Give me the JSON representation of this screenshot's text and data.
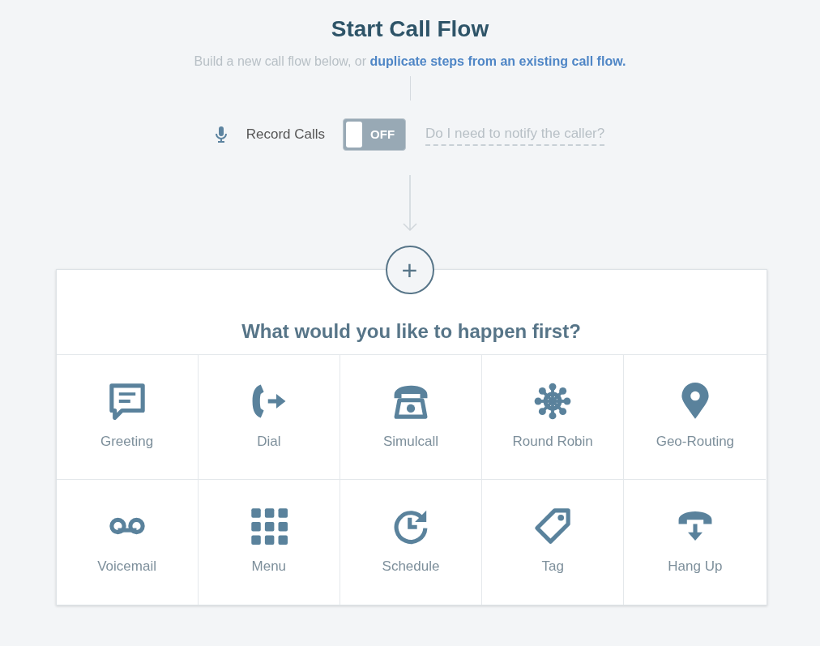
{
  "title": "Start Call Flow",
  "subtitle": {
    "text": "Build a new call flow below, or ",
    "link": "duplicate steps from an existing call flow."
  },
  "record_calls": {
    "label": "Record Calls",
    "toggle": {
      "on": false,
      "label": "OFF"
    },
    "help_link": "Do I need to notify the caller?"
  },
  "add_button": "+",
  "question": "What would you like to happen first?",
  "actions": [
    {
      "kind": "greeting",
      "label": "Greeting"
    },
    {
      "kind": "dial",
      "label": "Dial"
    },
    {
      "kind": "simulcall",
      "label": "Simulcall"
    },
    {
      "kind": "roundrobin",
      "label": "Round Robin"
    },
    {
      "kind": "georouting",
      "label": "Geo-Routing"
    },
    {
      "kind": "voicemail",
      "label": "Voicemail"
    },
    {
      "kind": "menu",
      "label": "Menu"
    },
    {
      "kind": "schedule",
      "label": "Schedule"
    },
    {
      "kind": "tag",
      "label": "Tag"
    },
    {
      "kind": "hangup",
      "label": "Hang Up"
    }
  ]
}
